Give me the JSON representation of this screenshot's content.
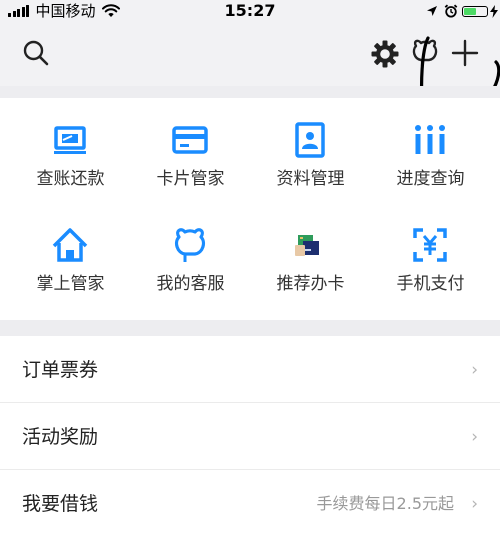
{
  "status_bar": {
    "carrier": "中国移动",
    "time": "15:27"
  },
  "toolbar": {
    "icons": [
      "search-icon",
      "settings-icon",
      "customer-service-icon",
      "add-icon"
    ]
  },
  "quick_actions": [
    {
      "label": "查账还款",
      "icon": "bill-repay-icon"
    },
    {
      "label": "卡片管家",
      "icon": "card-icon"
    },
    {
      "label": "资料管理",
      "icon": "profile-icon"
    },
    {
      "label": "进度查询",
      "icon": "progress-icon"
    },
    {
      "label": "掌上管家",
      "icon": "home-icon"
    },
    {
      "label": "我的客服",
      "icon": "service-icon"
    },
    {
      "label": "推荐办卡",
      "icon": "recommend-card-icon"
    },
    {
      "label": "手机支付",
      "icon": "mobile-pay-icon"
    }
  ],
  "menu": [
    {
      "label": "订单票券",
      "note": ""
    },
    {
      "label": "活动奖励",
      "note": ""
    },
    {
      "label": "我要借钱",
      "note": "手续费每日2.5元起"
    }
  ],
  "chevron": "›",
  "colors": {
    "accent": "#1a8cff",
    "background": "#f2f2f4",
    "text": "#222222",
    "muted": "#999999"
  }
}
